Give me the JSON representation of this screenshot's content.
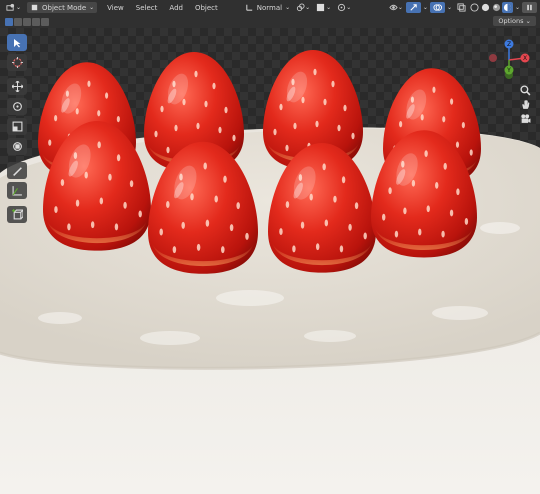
{
  "header": {
    "mode_label": "Object Mode",
    "menus": [
      "View",
      "Select",
      "Add",
      "Object"
    ],
    "transform_orientation": "Normal"
  },
  "toolbar": {
    "options_label": "Options"
  },
  "gizmo": {
    "z_label": "Z",
    "x_label": "X",
    "y_label": "Y"
  },
  "colors": {
    "accent": "#4772b3",
    "header_bg": "#303030",
    "x_axis": "#e5464f",
    "y_axis": "#5ea82e",
    "z_axis": "#3d7ae0"
  },
  "icons": [
    "editor-type-icon",
    "object-mode-icon",
    "transform-orientation-icon",
    "pivot-icon",
    "snap-icon",
    "proportional-edit-icon",
    "visibility-icon",
    "gizmo-icon",
    "overlay-icon",
    "xray-icon",
    "shading-wireframe-icon",
    "shading-solid-icon",
    "shading-material-icon",
    "shading-rendered-icon",
    "zoom-icon",
    "pan-hand-icon",
    "camera-icon",
    "select-box-icon",
    "cursor-icon",
    "move-icon",
    "rotate-icon",
    "scale-icon",
    "transform-icon",
    "annotate-icon",
    "measure-icon",
    "add-cube-icon"
  ]
}
